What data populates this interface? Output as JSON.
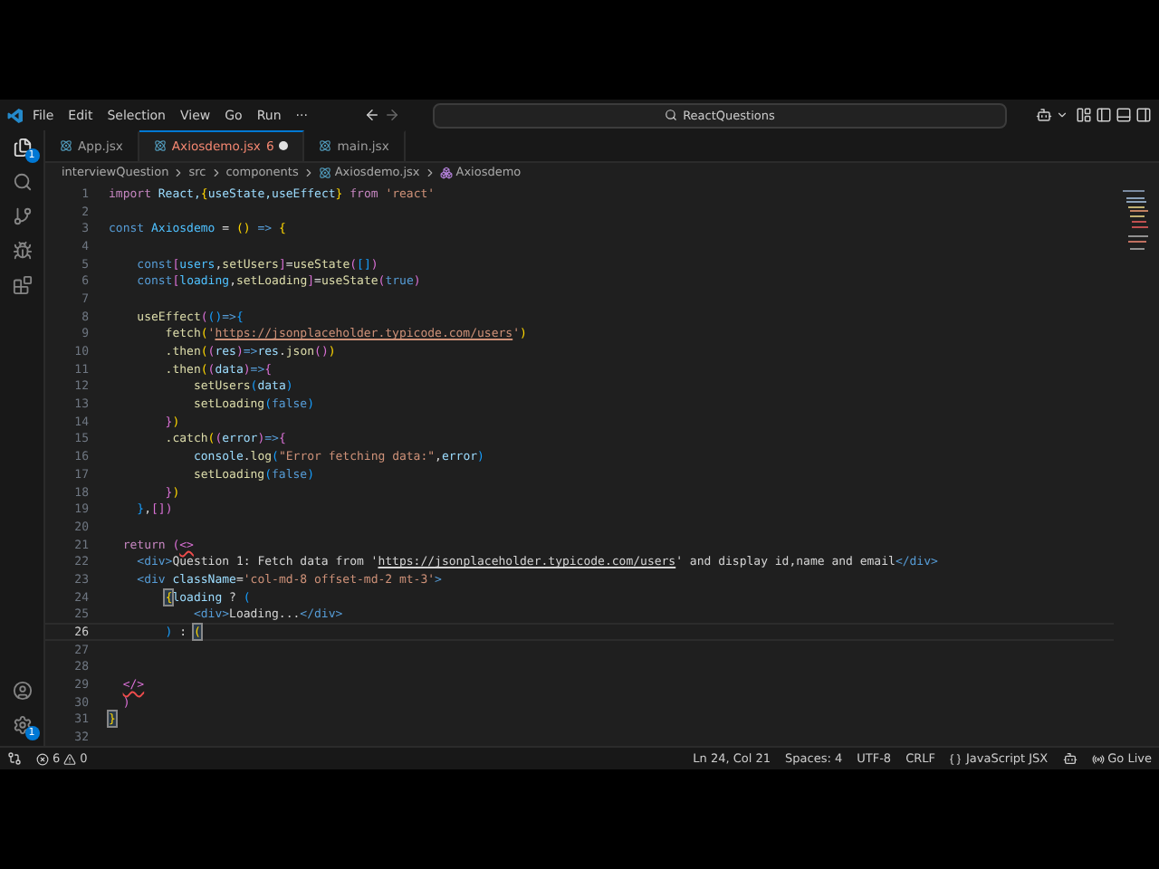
{
  "menu": [
    "File",
    "Edit",
    "Selection",
    "View",
    "Go",
    "Run",
    "···"
  ],
  "search": {
    "value": "ReactQuestions"
  },
  "activity_bar": {
    "explorer_badge": "1",
    "settings_badge": "1"
  },
  "tabs": [
    {
      "label": "App.jsx",
      "selected": false,
      "modified": false
    },
    {
      "label": "Axiosdemo.jsx",
      "problems": "6",
      "selected": true,
      "modified": true
    },
    {
      "label": "main.jsx",
      "selected": false,
      "modified": false
    }
  ],
  "breadcrumb": [
    "interviewQuestion",
    "src",
    "components",
    "Axiosdemo.jsx",
    "Axiosdemo"
  ],
  "code": [
    {
      "n": "1",
      "current": false,
      "tokens": [
        {
          "text": "import",
          "kind": "kw"
        },
        {
          "text": " React,",
          "kind": "var"
        },
        {
          "text": "{",
          "kind": "b1"
        },
        {
          "text": "useState,",
          "kind": "var"
        },
        {
          "text": "useEffect",
          "kind": "var"
        },
        {
          "text": "}",
          "kind": "b1"
        },
        {
          "text": " from",
          "kind": "kw"
        },
        {
          "text": " 'react'",
          "kind": "str"
        }
      ]
    },
    {
      "n": "2",
      "current": false
    },
    {
      "n": "3",
      "current": false,
      "tokens": [
        {
          "text": "const",
          "kind": "decl"
        },
        {
          "text": " Axiosdemo",
          "kind": "const"
        },
        {
          "text": " = ",
          "kind": "punc"
        },
        {
          "text": "()",
          "kind": "b1"
        },
        {
          "text": " => ",
          "kind": "decl"
        },
        {
          "text": "{",
          "kind": "b1"
        }
      ]
    },
    {
      "n": "4",
      "current": false
    },
    {
      "n": "5",
      "current": false,
      "tokens": [
        {
          "text": "    const",
          "kind": "decl"
        },
        {
          "text": "[",
          "kind": "b2"
        },
        {
          "text": "users",
          "kind": "const"
        },
        {
          "text": ",",
          "kind": "punc"
        },
        {
          "text": "setUsers",
          "kind": "fn"
        },
        {
          "text": "]",
          "kind": "b2"
        },
        {
          "text": "=",
          "kind": "punc"
        },
        {
          "text": "useState",
          "kind": "fn"
        },
        {
          "text": "(",
          "kind": "b2"
        },
        {
          "text": "[]",
          "kind": "b3"
        },
        {
          "text": ")",
          "kind": "b2"
        }
      ]
    },
    {
      "n": "6",
      "current": false,
      "tokens": [
        {
          "text": "    const",
          "kind": "decl"
        },
        {
          "text": "[",
          "kind": "b2"
        },
        {
          "text": "loading",
          "kind": "const"
        },
        {
          "text": ",",
          "kind": "punc"
        },
        {
          "text": "setLoading",
          "kind": "fn"
        },
        {
          "text": "]",
          "kind": "b2"
        },
        {
          "text": "=",
          "kind": "punc"
        },
        {
          "text": "useState",
          "kind": "fn"
        },
        {
          "text": "(",
          "kind": "b2"
        },
        {
          "text": "true",
          "kind": "bool"
        },
        {
          "text": ")",
          "kind": "b2"
        }
      ]
    },
    {
      "n": "7",
      "current": false
    },
    {
      "n": "8",
      "current": false,
      "tokens": [
        {
          "text": "    useEffect",
          "kind": "fn"
        },
        {
          "text": "(",
          "kind": "b2"
        },
        {
          "text": "()",
          "kind": "b3"
        },
        {
          "text": "=>",
          "kind": "decl"
        },
        {
          "text": "{",
          "kind": "b3"
        }
      ]
    },
    {
      "n": "9",
      "current": false,
      "tokens": [
        {
          "text": "        fetch",
          "kind": "fn"
        },
        {
          "text": "(",
          "kind": "b1"
        },
        {
          "text": "'",
          "kind": "str"
        },
        {
          "text": "https://jsonplaceholder.typicode.com/users",
          "kind": "link"
        },
        {
          "text": "'",
          "kind": "str"
        },
        {
          "text": ")",
          "kind": "b1"
        }
      ]
    },
    {
      "n": "10",
      "current": false,
      "tokens": [
        {
          "text": "        .then",
          "kind": "fn"
        },
        {
          "text": "(",
          "kind": "b1"
        },
        {
          "text": "(",
          "kind": "b2"
        },
        {
          "text": "res",
          "kind": "var"
        },
        {
          "text": ")",
          "kind": "b2"
        },
        {
          "text": "=>",
          "kind": "decl"
        },
        {
          "text": "res",
          "kind": "var"
        },
        {
          "text": ".",
          "kind": "punc"
        },
        {
          "text": "json",
          "kind": "fn"
        },
        {
          "text": "()",
          "kind": "b2"
        },
        {
          "text": ")",
          "kind": "b1"
        }
      ]
    },
    {
      "n": "11",
      "current": false,
      "tokens": [
        {
          "text": "        .then",
          "kind": "fn"
        },
        {
          "text": "(",
          "kind": "b1"
        },
        {
          "text": "(",
          "kind": "b2"
        },
        {
          "text": "data",
          "kind": "var"
        },
        {
          "text": ")",
          "kind": "b2"
        },
        {
          "text": "=>",
          "kind": "decl"
        },
        {
          "text": "{",
          "kind": "b2"
        }
      ]
    },
    {
      "n": "12",
      "current": false,
      "tokens": [
        {
          "text": "            setUsers",
          "kind": "fn"
        },
        {
          "text": "(",
          "kind": "b3"
        },
        {
          "text": "data",
          "kind": "var"
        },
        {
          "text": ")",
          "kind": "b3"
        }
      ]
    },
    {
      "n": "13",
      "current": false,
      "tokens": [
        {
          "text": "            setLoading",
          "kind": "fn"
        },
        {
          "text": "(",
          "kind": "b3"
        },
        {
          "text": "false",
          "kind": "bool"
        },
        {
          "text": ")",
          "kind": "b3"
        }
      ]
    },
    {
      "n": "14",
      "current": false,
      "tokens": [
        {
          "text": "        }",
          "kind": "b2"
        },
        {
          "text": ")",
          "kind": "b1"
        }
      ]
    },
    {
      "n": "15",
      "current": false,
      "tokens": [
        {
          "text": "        .catch",
          "kind": "fn"
        },
        {
          "text": "(",
          "kind": "b1"
        },
        {
          "text": "(",
          "kind": "b2"
        },
        {
          "text": "error",
          "kind": "var"
        },
        {
          "text": ")",
          "kind": "b2"
        },
        {
          "text": "=>",
          "kind": "decl"
        },
        {
          "text": "{",
          "kind": "b2"
        }
      ]
    },
    {
      "n": "16",
      "current": false,
      "tokens": [
        {
          "text": "            console",
          "kind": "var"
        },
        {
          "text": ".",
          "kind": "punc"
        },
        {
          "text": "log",
          "kind": "fn"
        },
        {
          "text": "(",
          "kind": "b3"
        },
        {
          "text": "\"Error fetching data:\"",
          "kind": "str"
        },
        {
          "text": ",",
          "kind": "punc"
        },
        {
          "text": "error",
          "kind": "var"
        },
        {
          "text": ")",
          "kind": "b3"
        }
      ]
    },
    {
      "n": "17",
      "current": false,
      "tokens": [
        {
          "text": "            setLoading",
          "kind": "fn"
        },
        {
          "text": "(",
          "kind": "b3"
        },
        {
          "text": "false",
          "kind": "bool"
        },
        {
          "text": ")",
          "kind": "b3"
        }
      ]
    },
    {
      "n": "18",
      "current": false,
      "tokens": [
        {
          "text": "        }",
          "kind": "b2"
        },
        {
          "text": ")",
          "kind": "b1"
        }
      ]
    },
    {
      "n": "19",
      "current": false,
      "tokens": [
        {
          "text": "    }",
          "kind": "b3"
        },
        {
          "text": ",",
          "kind": "punc"
        },
        {
          "text": "[]",
          "kind": "b2"
        },
        {
          "text": ")",
          "kind": "b2"
        }
      ]
    },
    {
      "n": "20",
      "current": false
    },
    {
      "n": "21",
      "current": false,
      "tokens": [
        {
          "text": "  return",
          "kind": "kw"
        },
        {
          "text": " (",
          "kind": "b2"
        },
        {
          "text": "<>",
          "kind": "err"
        }
      ]
    },
    {
      "n": "22",
      "current": false,
      "tokens": [
        {
          "text": "    <div>",
          "kind": "tag"
        },
        {
          "text": "Question 1: Fetch data from '",
          "kind": "text"
        },
        {
          "text": "https://jsonplaceholder.typicode.com/users",
          "kind": "textlink"
        },
        {
          "text": "' and display id,name and email",
          "kind": "text"
        },
        {
          "text": "</div>",
          "kind": "tag"
        }
      ]
    },
    {
      "n": "23",
      "current": false,
      "tokens": [
        {
          "text": "    <div",
          "kind": "tag"
        },
        {
          "text": " className",
          "kind": "attr"
        },
        {
          "text": "=",
          "kind": "punc"
        },
        {
          "text": "'col-md-8 offset-md-2 mt-3'",
          "kind": "str"
        },
        {
          "text": ">",
          "kind": "tag"
        }
      ]
    },
    {
      "n": "24",
      "current": false,
      "tokens": [
        {
          "text": "        {",
          "kind": "match"
        },
        {
          "text": "loading",
          "kind": "var"
        },
        {
          "text": " ? ",
          "kind": "punc"
        },
        {
          "text": "(",
          "kind": "b3"
        }
      ]
    },
    {
      "n": "25",
      "current": false,
      "tokens": [
        {
          "text": "            <div>",
          "kind": "tag"
        },
        {
          "text": "Loading...",
          "kind": "text"
        },
        {
          "text": "</div>",
          "kind": "tag"
        }
      ]
    },
    {
      "n": "26",
      "current": true,
      "tokens": [
        {
          "text": "        )",
          "kind": "b3"
        },
        {
          "text": " : ",
          "kind": "punc"
        },
        {
          "text": "(",
          "kind": "match"
        }
      ]
    },
    {
      "n": "27",
      "current": false
    },
    {
      "n": "28",
      "current": false
    },
    {
      "n": "29",
      "current": false,
      "tokens": [
        {
          "text": "  </>",
          "kind": "err"
        }
      ]
    },
    {
      "n": "30",
      "current": false,
      "tokens": [
        {
          "text": "  )",
          "kind": "b2"
        }
      ]
    },
    {
      "n": "31",
      "current": false,
      "tokens": [
        {
          "text": "}",
          "kind": "match"
        }
      ]
    },
    {
      "n": "32",
      "current": false
    }
  ],
  "status_bar": {
    "errors": "6",
    "warnings": "0",
    "items": [
      "Ln 24, Col 21",
      "Spaces: 4",
      "UTF-8",
      "CRLF"
    ],
    "language": "JavaScript JSX",
    "go_live": "Go Live"
  }
}
